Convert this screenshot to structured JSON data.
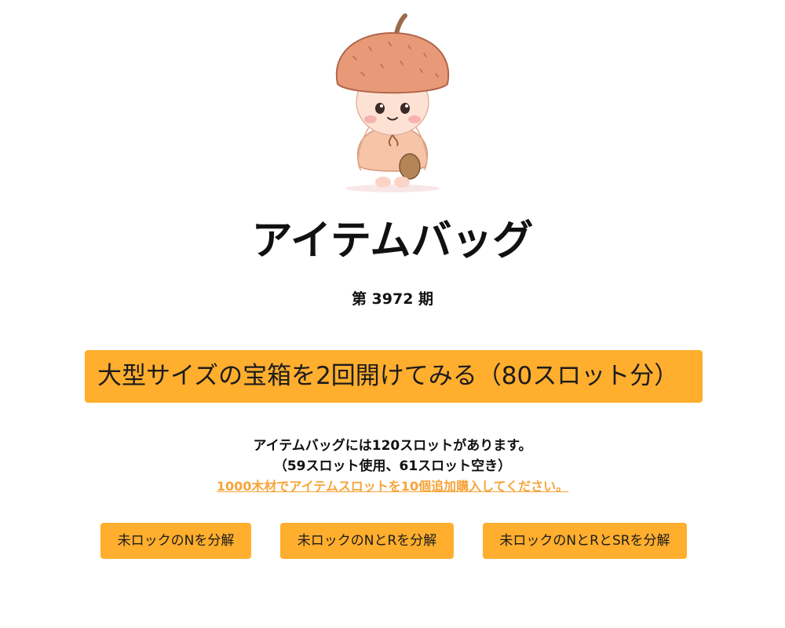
{
  "page": {
    "title": "アイテムバッグ",
    "season": "第 3972 期"
  },
  "open_chest_button": {
    "label": "大型サイズの宝箱を2回開けてみる（80スロット分）"
  },
  "bag_info": {
    "line1": "アイテムバッグには120スロットがあります。",
    "line2": "（59スロット使用、61スロット空き）",
    "purchase_link": "1000木材でアイテムスロットを10個追加購入してください。"
  },
  "dismantle_buttons": [
    {
      "label": "未ロックのNを分解"
    },
    {
      "label": "未ロックのNとRを分解"
    },
    {
      "label": "未ロックのNとRとSRを分解"
    }
  ],
  "colors": {
    "accent": "#ffae2e",
    "link": "#f7a43a"
  },
  "mascot": {
    "icon": "acorn-mascot-icon"
  }
}
